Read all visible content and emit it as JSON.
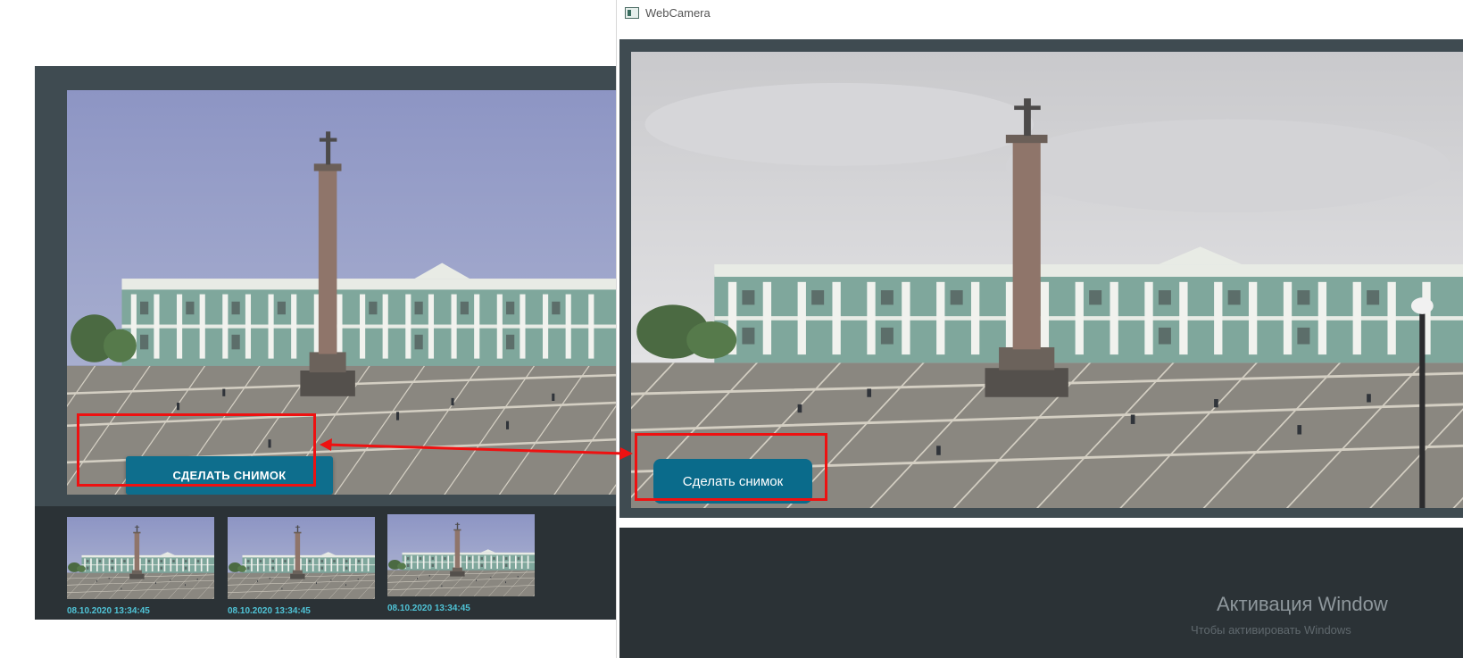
{
  "left_panel": {
    "capture_button_label": "СДЕЛАТЬ СНИМОК",
    "thumbnails": [
      {
        "timestamp": "08.10.2020 13:34:45"
      },
      {
        "timestamp": "08.10.2020 13:34:45"
      },
      {
        "timestamp": "08.10.2020 13:34:45"
      }
    ]
  },
  "window": {
    "title": "WebCamera",
    "capture_button_label": "Сделать снимок",
    "activation_title": "Активация Window",
    "activation_subtitle": "Чтобы активировать Windows"
  },
  "colors": {
    "panel_dark": "#2b3236",
    "panel_mid": "#3f4b51",
    "button": "#0e6e8d",
    "timestamp": "#4fc3d6",
    "annotation": "#ee1111"
  },
  "icons": {
    "window_app_icon": "app-window-icon",
    "annotation_arrow": "double-arrow-icon"
  }
}
